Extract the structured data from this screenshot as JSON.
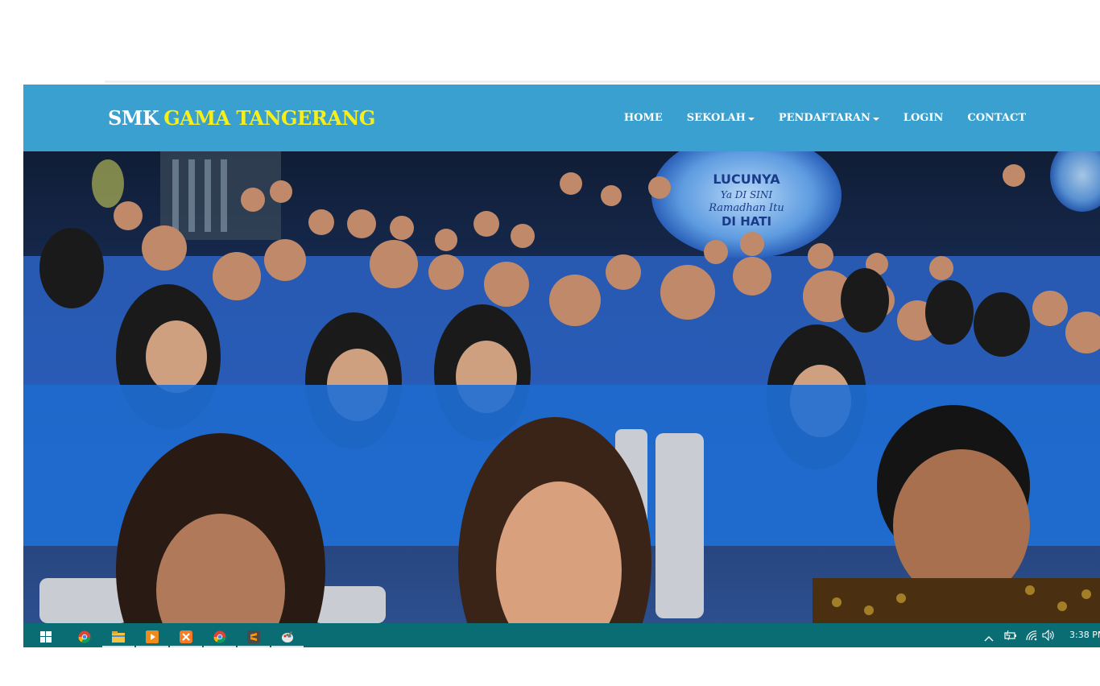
{
  "brand": {
    "part1": "SMK",
    "part2": "GAMA TANGERANG"
  },
  "nav": {
    "home": "HOME",
    "sekolah": "SEKOLAH",
    "pendaftaran": "PENDAFTARAN",
    "login": "LOGIN",
    "contact": "CONTACT"
  },
  "hero": {
    "image": "group-photo",
    "stage_sign_lines": [
      "LUCUNYA",
      "Ya DI SINI",
      "Ramadhan Itu",
      "DI HATI"
    ]
  },
  "taskbar": {
    "apps": [
      "windows-start-icon",
      "chrome-icon",
      "file-explorer-icon",
      "media-player-icon",
      "xampp-icon",
      "chrome-icon",
      "sublime-text-icon",
      "paint-icon"
    ],
    "tray": [
      "chevron-up-icon",
      "battery-icon",
      "wifi-icon",
      "volume-icon"
    ],
    "clock": "3:38 PM"
  },
  "colors": {
    "navbar": "#3aa0cf",
    "brand_accent": "#f7ee1a",
    "taskbar": "#0a6d74"
  }
}
